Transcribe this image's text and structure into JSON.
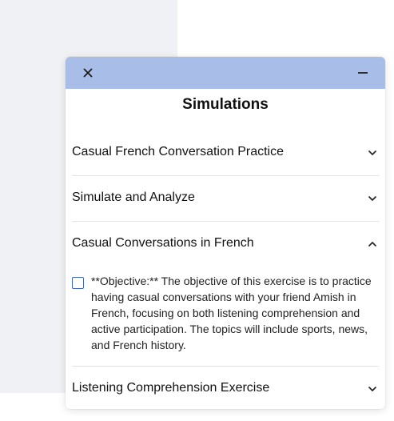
{
  "dialog": {
    "title": "Simulations",
    "close_icon": "close-icon",
    "minimize_icon": "minimize-icon"
  },
  "accordion": [
    {
      "label": "Casual French Conversation Practice",
      "expanded": false
    },
    {
      "label": "Simulate and Analyze",
      "expanded": false
    },
    {
      "label": "Casual Conversations in French",
      "expanded": true
    },
    {
      "label": "Listening Comprehension Exercise",
      "expanded": false
    }
  ],
  "task": {
    "checked": false,
    "text": "**Objective:** The objective of this exercise is to practice having casual conversations with your friend Amish in French, focusing on both listening comprehension and active participation. The topics will include sports, news, and French history."
  },
  "colors": {
    "titlebar": "#a8bde8",
    "checkbox_border": "#3d66b8",
    "background_panel": "#f0f1f4"
  }
}
